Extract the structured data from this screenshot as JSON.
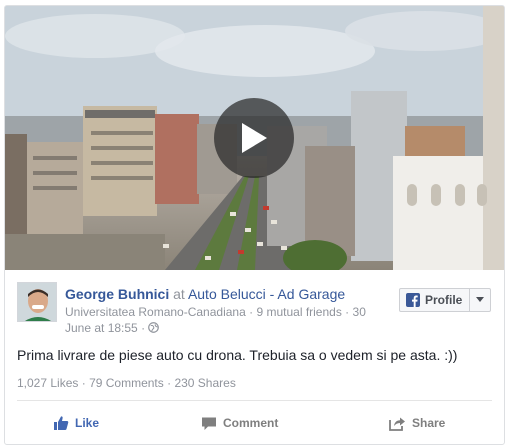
{
  "post": {
    "author": "George Buhnici",
    "at": "at",
    "page": "Auto Belucci - Ad Garage",
    "meta_location": "Universitatea Romano-Canadiana",
    "meta_sep1": " · ",
    "meta_friends": "9 mutual friends",
    "meta_sep2": " · ",
    "meta_date": "30 June at 18:55",
    "meta_sep3": " · ",
    "privacy_icon": "globe-icon",
    "text": "Prima livrare de piese auto cu drona. Trebuia sa o vedem si pe asta. :))",
    "likes": "1,027 Likes",
    "comments": "79 Comments",
    "shares": "230 Shares",
    "dot": " · "
  },
  "profile_button": {
    "label": "Profile",
    "icon": "facebook-icon",
    "caret_icon": "caret-down-icon"
  },
  "actions": {
    "like": "Like",
    "comment": "Comment",
    "share": "Share"
  },
  "video": {
    "play_icon": "play-icon"
  },
  "colors": {
    "link": "#365899",
    "muted": "#90949c",
    "like_blue": "#4267b2",
    "facebook_blue": "#3b5998"
  }
}
